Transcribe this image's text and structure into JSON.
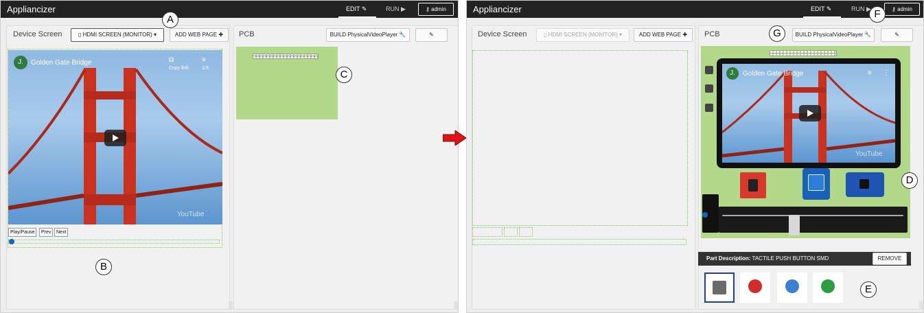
{
  "app": {
    "name": "Appliancizer",
    "edit_label": "EDIT",
    "run_label": "RUN",
    "admin_label": "admin"
  },
  "device_screen": {
    "title": "Device Screen",
    "screen_select": "HDMI SCREEN (MONITOR)",
    "add_page_label": "ADD WEB PAGE"
  },
  "pcb": {
    "title": "PCB",
    "build_label": "BUILD PhysicalVideoPlayer"
  },
  "video": {
    "avatar_letter": "J.",
    "title": "Golden Gate Bridge",
    "copy_label": "Copy link",
    "playlist_count": "1/3",
    "brand": "YouTube"
  },
  "controls": {
    "play_pause": "Play/Pause",
    "prev": "Prev",
    "next": "Next"
  },
  "part": {
    "description_label": "Part Description:",
    "description_value": "TACTILE PUSH BUTTON SMD",
    "remove_label": "REMOVE"
  },
  "parts": [
    {
      "name": "Tactile button",
      "color": "#6a6a6a"
    },
    {
      "name": "Red button",
      "color": "#d12b2b"
    },
    {
      "name": "Blue button",
      "color": "#3f7fd1"
    },
    {
      "name": "Green button",
      "color": "#2c9e3f"
    }
  ],
  "callouts": {
    "a": "A",
    "b": "B",
    "c": "C",
    "d": "D",
    "e": "E",
    "f": "F",
    "g": "G"
  },
  "colors": {
    "topbar": "#222222",
    "pcb_green": "#b2d98a",
    "arrow": "#e01414",
    "selection": "#1e3fa8"
  }
}
